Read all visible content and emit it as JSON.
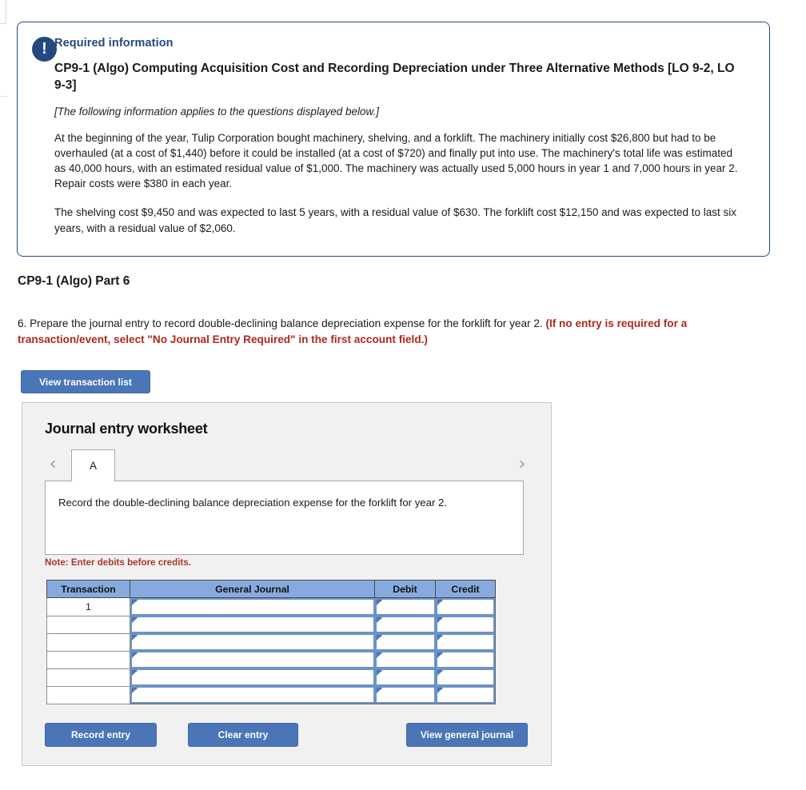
{
  "required_info": {
    "icon": "exclamation-icon",
    "label": "Required information",
    "title": "CP9-1 (Algo) Computing Acquisition Cost and Recording Depreciation under Three Alternative Methods [LO 9-2, LO 9-3]",
    "subtitle": "[The following information applies to the questions displayed below.]",
    "paragraph1": "At the beginning of the year, Tulip Corporation bought machinery, shelving, and a forklift. The machinery initially cost $26,800 but had to be overhauled (at a cost of $1,440) before it could be installed (at a cost of $720) and finally put into use. The machinery's total life was estimated as 40,000 hours, with an estimated residual value of $1,000. The machinery was actually used 5,000 hours in year 1 and 7,000 hours in year 2. Repair costs were $380 in each year.",
    "paragraph2": "The shelving cost $9,450 and was expected to last 5 years, with a residual value of $630. The forklift cost $12,150 and was expected to last six years, with a residual value of $2,060."
  },
  "part": {
    "heading": "CP9-1 (Algo) Part 6",
    "question_black": "6. Prepare the journal entry to record double-declining balance depreciation expense for the forklift for year 2. ",
    "question_red": "(If no entry is required for a transaction/event, select \"No Journal Entry Required\" in the first account field.)"
  },
  "toolbar": {
    "view_transaction_list_label": "View transaction list"
  },
  "worksheet": {
    "title": "Journal entry worksheet",
    "prev_icon": "chevron-left-icon",
    "next_icon": "chevron-right-icon",
    "tabs": [
      {
        "label": "A",
        "active": true
      }
    ],
    "instruction": "Record the double-declining balance depreciation expense for the forklift for year 2.",
    "note": "Note: Enter debits before credits.",
    "table": {
      "columns": [
        "Transaction",
        "General Journal",
        "Debit",
        "Credit"
      ],
      "rows": [
        {
          "transaction": "1",
          "general_journal": "",
          "debit": "",
          "credit": ""
        },
        {
          "transaction": "",
          "general_journal": "",
          "debit": "",
          "credit": ""
        },
        {
          "transaction": "",
          "general_journal": "",
          "debit": "",
          "credit": ""
        },
        {
          "transaction": "",
          "general_journal": "",
          "debit": "",
          "credit": ""
        },
        {
          "transaction": "",
          "general_journal": "",
          "debit": "",
          "credit": ""
        },
        {
          "transaction": "",
          "general_journal": "",
          "debit": "",
          "credit": ""
        }
      ]
    },
    "buttons": {
      "record_entry": "Record entry",
      "clear_entry": "Clear entry",
      "view_general_journal": "View general journal"
    }
  },
  "colors": {
    "accent_blue": "#4a76b8",
    "navy": "#24497e",
    "header_blue": "#87aade",
    "alert_red": "#b0281c",
    "panel_bg": "#f1f1f1"
  }
}
